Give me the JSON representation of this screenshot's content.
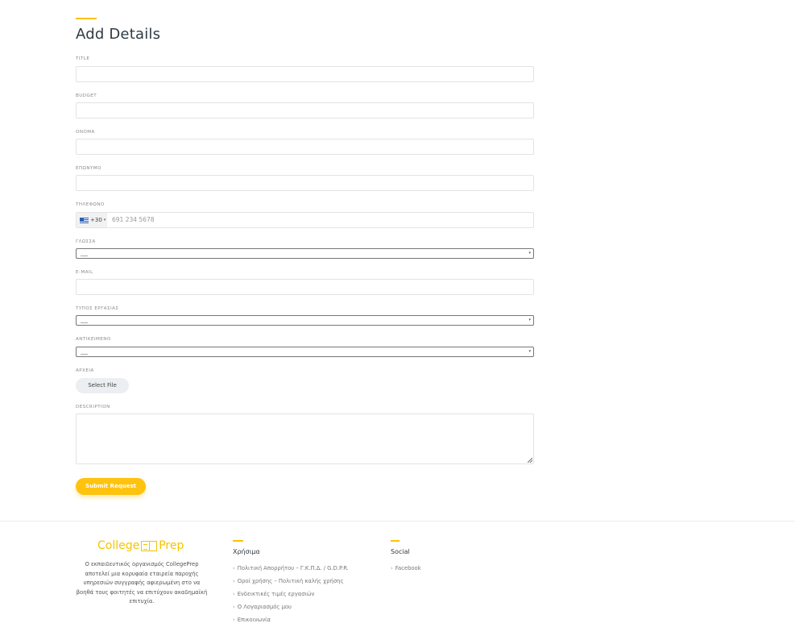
{
  "form": {
    "title": "Add Details",
    "fields": {
      "title_label": "TITLE",
      "budget_label": "BUDGET",
      "first_name_label": "ΟΝΟΜΑ",
      "last_name_label": "ΕΠΩΝΥΜΟ",
      "phone_label": "ΤΗΛΕΦΩΝΟ",
      "phone_dial_code": "+30",
      "phone_placeholder": "691 234 5678",
      "language_label": "ΓΛΩΣΣΑ",
      "language_value": "___",
      "email_label": "E-MAIL",
      "work_type_label": "ΤΥΠΟΣ ΕΡΓΑΣΙΑΣ",
      "work_type_value": "___",
      "subject_label": "ΑΝΤΙΚΕΙΜΕΝΟ",
      "subject_value": "___",
      "files_label": "ΑΡΧΕΙΑ",
      "select_file_label": "Select File",
      "description_label": "DESCRIPTION"
    },
    "submit_label": "Submit Request"
  },
  "footer": {
    "logo_text_left": "College",
    "logo_text_right": "Prep",
    "about": "Ο εκπαιδευτικός οργανισμός CollegePrep αποτελεί μια κορυφαία εταιρεία παροχής υπηρεσιών συγγραφής αφιερωμένη στο να βοηθά τους φοιτητές να επιτύχουν ακαδημαϊκή επιτυχία.",
    "useful": {
      "title": "Χρήσιμα",
      "links": [
        "Πολιτική Απορρήτου – Γ.Κ.Π.Δ. / G.D.P.R.",
        "Οροί χρήσης – Πολιτική καλής χρήσης",
        "Ενδεικτικές τιμές εργασιών",
        "Ο Λογαριασμός μου",
        "Επικοινωνία"
      ]
    },
    "social": {
      "title": "Social",
      "links": [
        "Facebook"
      ]
    }
  },
  "colors": {
    "accent": "#ffc107",
    "heading": "#2f3b45"
  }
}
